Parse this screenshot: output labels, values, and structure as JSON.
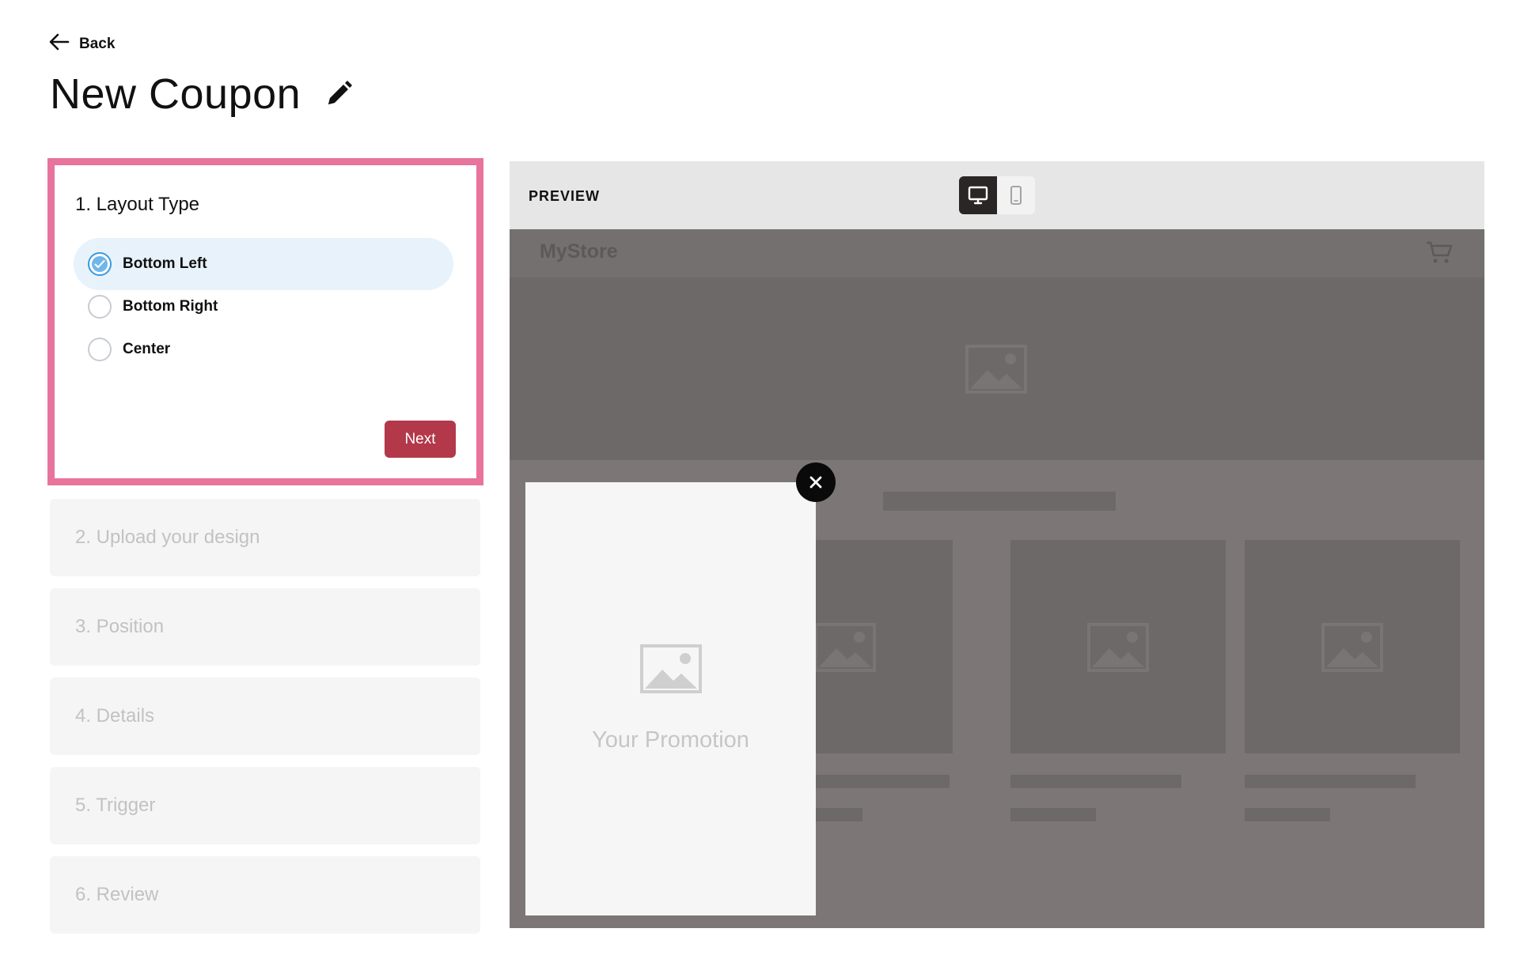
{
  "header": {
    "back_label": "Back",
    "page_title": "New Coupon"
  },
  "steps": {
    "active": {
      "title": "1. Layout Type",
      "options": [
        {
          "label": "Bottom Left",
          "selected": true
        },
        {
          "label": "Bottom Right",
          "selected": false
        },
        {
          "label": "Center",
          "selected": false
        }
      ],
      "next_label": "Next"
    },
    "collapsed": [
      {
        "label": "2. Upload your design"
      },
      {
        "label": "3. Position"
      },
      {
        "label": "4. Details"
      },
      {
        "label": "5. Trigger"
      },
      {
        "label": "6. Review"
      }
    ]
  },
  "preview": {
    "label": "PREVIEW",
    "active_device": "desktop",
    "store_name": "MyStore",
    "promo_text": "Your Promotion"
  },
  "colors": {
    "accent_border": "#e8739d",
    "next_button": "#b2384a",
    "selected_option_bg": "#e8f2fa",
    "radio_selected": "#3b9ad9",
    "preview_overlay": "#7c7676"
  },
  "icons": [
    "arrow-left-icon",
    "pencil-icon",
    "check-icon",
    "desktop-icon",
    "mobile-icon",
    "cart-icon",
    "image-placeholder-icon",
    "close-icon"
  ]
}
